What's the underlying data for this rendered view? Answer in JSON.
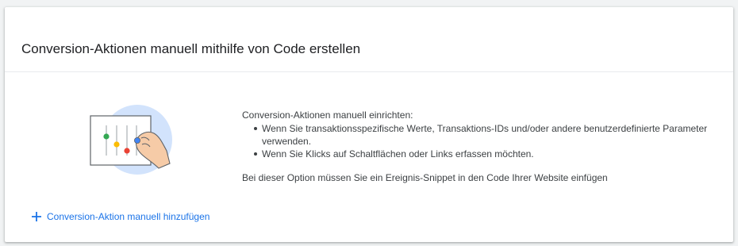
{
  "card": {
    "title": "Conversion-Aktionen manuell mithilfe von Code erstellen"
  },
  "illustration": {
    "icon": "code-conversion-illustration",
    "colors": {
      "circle": "#d2e3fc",
      "green": "#34a853",
      "yellow": "#fbbc04",
      "red": "#ea4335",
      "blue": "#4285f4",
      "skin": "#f6cba7",
      "outline": "#5f6368"
    }
  },
  "info": {
    "intro": "Conversion-Aktionen manuell einrichten:",
    "bullets": [
      "Wenn Sie transaktionsspezifische Werte, Transaktions-IDs und/oder andere benutzerdefinierte Parameter verwenden.",
      "Wenn Sie Klicks auf Schaltflächen oder Links erfassen möchten."
    ],
    "note": "Bei dieser Option müssen Sie ein Ereignis-Snippet in den Code Ihrer Website einfügen"
  },
  "add_action": {
    "icon": "plus-icon",
    "label": "Conversion-Aktion manuell hinzufügen",
    "color": "#1a73e8"
  }
}
